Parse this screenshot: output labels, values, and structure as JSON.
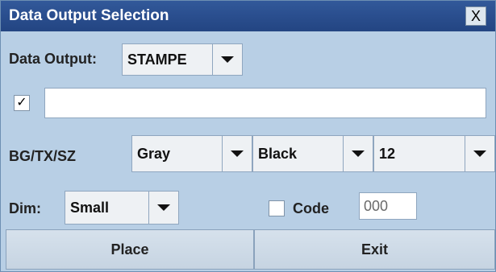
{
  "window": {
    "title": "Data Output Selection",
    "close_glyph": "X"
  },
  "data_output": {
    "label": "Data Output:",
    "selected": "STAMPE"
  },
  "text_row": {
    "checkbox_checked": true,
    "checkbox_glyph": "✓",
    "value": ""
  },
  "colors": {
    "label": "BG/TX/SZ",
    "background": "Gray",
    "text": "Black",
    "size": "12"
  },
  "dim": {
    "label": "Dim:",
    "selected": "Small"
  },
  "code": {
    "checked": false,
    "label": "Code",
    "value": "000"
  },
  "buttons": {
    "place": "Place",
    "exit": "Exit"
  },
  "theme": {
    "titlebar": "#2a4e8e",
    "panel": "#b8cfe5"
  }
}
